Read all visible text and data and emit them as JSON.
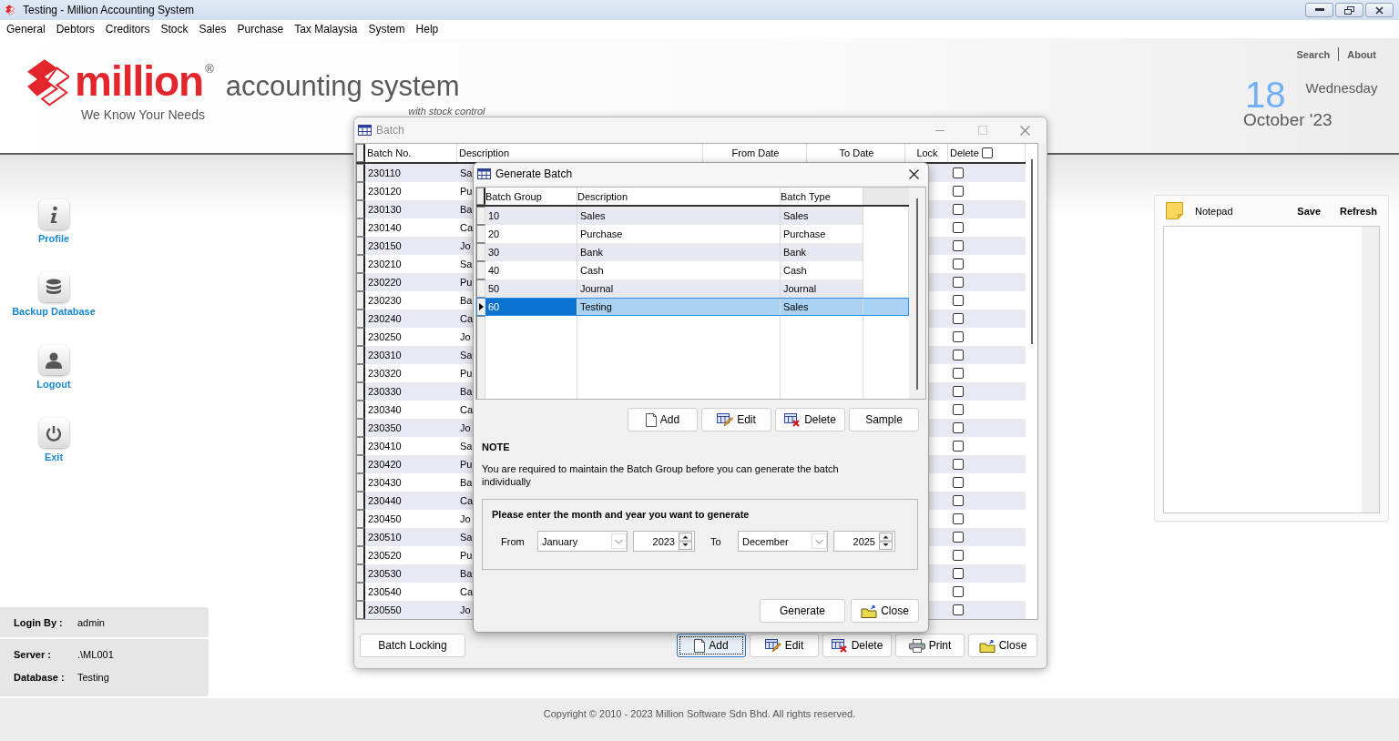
{
  "window": {
    "title": "Testing - Million Accounting System"
  },
  "menu": [
    "General",
    "Debtors",
    "Creditors",
    "Stock",
    "Sales",
    "Purchase",
    "Tax Malaysia",
    "System",
    "Help"
  ],
  "header": {
    "brand": "million",
    "registered": "®",
    "product": "accounting system",
    "edition": "with stock control",
    "slogan": "We Know Your Needs",
    "links": [
      "Search",
      "About"
    ],
    "day": "18",
    "weekday": "Wednesday",
    "month_year": "October '23"
  },
  "sidebar": {
    "items": [
      {
        "label": "Profile",
        "kind": "info"
      },
      {
        "label": "Backup Database",
        "kind": "database"
      },
      {
        "label": "Logout",
        "kind": "user"
      },
      {
        "label": "Exit",
        "kind": "power"
      }
    ]
  },
  "session": [
    {
      "label": "Login By :",
      "value": "admin"
    },
    {
      "label": "Server :",
      "value": ".\\ML001"
    },
    {
      "label": "Database :",
      "value": "Testing"
    }
  ],
  "notepad": {
    "title": "Notepad",
    "actions": [
      "Save",
      "Refresh"
    ]
  },
  "batch_window": {
    "title": "Batch",
    "table": {
      "columns": [
        "Batch No.",
        "Description",
        "From Date",
        "To Date",
        "Lock",
        "Delete"
      ],
      "delete_all": {
        "checked": false
      },
      "rows": [
        {
          "batch_no": "230110",
          "description": "Sa",
          "delete": false
        },
        {
          "batch_no": "230120",
          "description": "Pu",
          "delete": false
        },
        {
          "batch_no": "230130",
          "description": "Ba",
          "delete": false
        },
        {
          "batch_no": "230140",
          "description": "Ca",
          "delete": false
        },
        {
          "batch_no": "230150",
          "description": "Jo",
          "delete": false
        },
        {
          "batch_no": "230210",
          "description": "Sa",
          "delete": false
        },
        {
          "batch_no": "230220",
          "description": "Pu",
          "delete": false
        },
        {
          "batch_no": "230230",
          "description": "Ba",
          "delete": false
        },
        {
          "batch_no": "230240",
          "description": "Ca",
          "delete": false
        },
        {
          "batch_no": "230250",
          "description": "Jo",
          "delete": false
        },
        {
          "batch_no": "230310",
          "description": "Sa",
          "delete": false
        },
        {
          "batch_no": "230320",
          "description": "Pu",
          "delete": false
        },
        {
          "batch_no": "230330",
          "description": "Ba",
          "delete": false
        },
        {
          "batch_no": "230340",
          "description": "Ca",
          "delete": false
        },
        {
          "batch_no": "230350",
          "description": "Jo",
          "delete": false
        },
        {
          "batch_no": "230410",
          "description": "Sa",
          "delete": false
        },
        {
          "batch_no": "230420",
          "description": "Pu",
          "delete": false
        },
        {
          "batch_no": "230430",
          "description": "Ba",
          "delete": false
        },
        {
          "batch_no": "230440",
          "description": "Ca",
          "delete": false
        },
        {
          "batch_no": "230450",
          "description": "Jo",
          "delete": false
        },
        {
          "batch_no": "230510",
          "description": "Sa",
          "delete": false
        },
        {
          "batch_no": "230520",
          "description": "Pu",
          "delete": false
        },
        {
          "batch_no": "230530",
          "description": "Ba",
          "delete": false
        },
        {
          "batch_no": "230540",
          "description": "Ca",
          "delete": false
        },
        {
          "batch_no": "230550",
          "description": "Jo",
          "delete": false
        }
      ]
    },
    "buttons": [
      {
        "label": "Batch Locking",
        "kind": "locking",
        "focused": false
      },
      {
        "label": "Add",
        "kind": "add",
        "focused": true
      },
      {
        "label": "Edit",
        "kind": "edit",
        "focused": false
      },
      {
        "label": "Delete",
        "kind": "delete",
        "focused": false
      },
      {
        "label": "Print",
        "kind": "print",
        "focused": false
      },
      {
        "label": "Close",
        "kind": "close",
        "focused": false
      }
    ]
  },
  "generate_dialog": {
    "title": "Generate Batch",
    "grid": {
      "columns": [
        "Batch Group",
        "Description",
        "Batch Type"
      ],
      "rows": [
        {
          "group": "10",
          "description": "Sales",
          "type": "Sales",
          "selected": false
        },
        {
          "group": "20",
          "description": "Purchase",
          "type": "Purchase",
          "selected": false
        },
        {
          "group": "30",
          "description": "Bank",
          "type": "Bank",
          "selected": false
        },
        {
          "group": "40",
          "description": "Cash",
          "type": "Cash",
          "selected": false
        },
        {
          "group": "50",
          "description": "Journal",
          "type": "Journal",
          "selected": false
        },
        {
          "group": "60",
          "description": "Testing",
          "type": "Sales",
          "selected": true
        }
      ]
    },
    "grid_buttons": [
      {
        "label": "Add",
        "kind": "add"
      },
      {
        "label": "Edit",
        "kind": "edit"
      },
      {
        "label": "Delete",
        "kind": "delete"
      },
      {
        "label": "Sample",
        "kind": "sample"
      }
    ],
    "note_title": "NOTE",
    "note": "You are required to maintain the Batch Group before you can generate the batch individually",
    "period": {
      "prompt": "Please enter the month and year you want to generate",
      "from_label": "From",
      "from_month": "January",
      "from_year": "2023",
      "to_label": "To",
      "to_month": "December",
      "to_year": "2025"
    },
    "buttons": [
      {
        "label": "Generate",
        "kind": "generate"
      },
      {
        "label": "Close",
        "kind": "close"
      }
    ]
  },
  "footer": "Copyright © 2010 - 2023 Million Software Sdn Bhd. All rights reserved."
}
